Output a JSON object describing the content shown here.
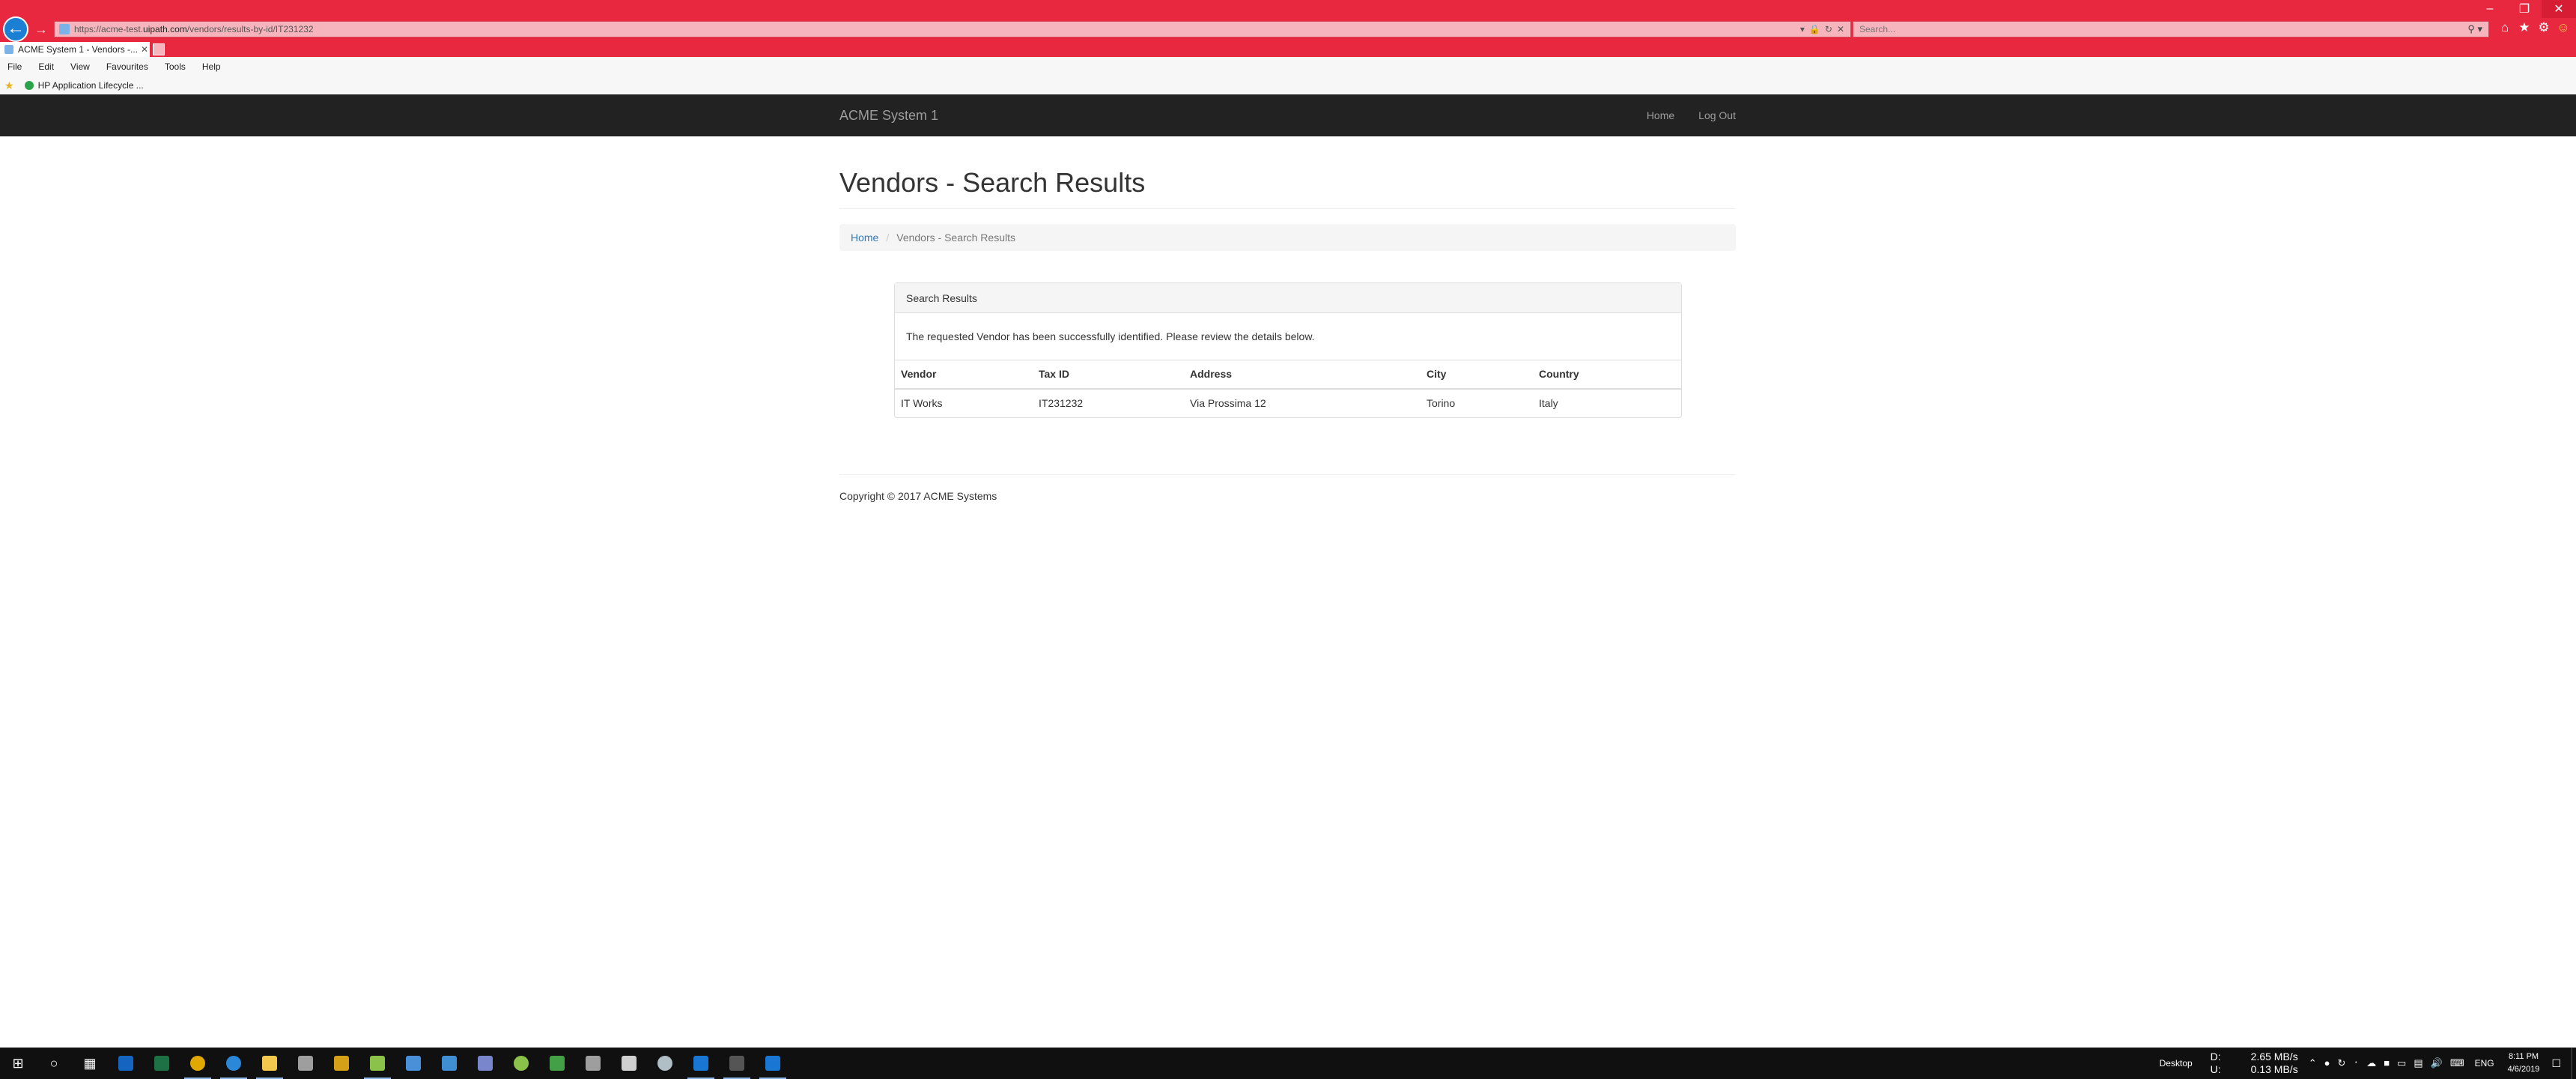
{
  "browser": {
    "url_prefix": "https://acme-test.",
    "url_host": "uipath.com",
    "url_path": "/vendors/results-by-id/IT231232",
    "search_placeholder": "Search...",
    "tab_title": "ACME System 1 - Vendors -...",
    "menu": [
      "File",
      "Edit",
      "View",
      "Favourites",
      "Tools",
      "Help"
    ],
    "favourite": "HP Application Lifecycle ..."
  },
  "site": {
    "brand": "ACME System 1",
    "nav": {
      "home": "Home",
      "logout": "Log Out"
    }
  },
  "page": {
    "title": "Vendors - Search Results",
    "breadcrumb": {
      "home": "Home",
      "separator": "/",
      "current": "Vendors - Search Results"
    },
    "panel": {
      "heading": "Search Results",
      "message": "The requested Vendor has been successfully identified. Please review the details below.",
      "columns": [
        "Vendor",
        "Tax ID",
        "Address",
        "City",
        "Country"
      ],
      "rows": [
        [
          "IT Works",
          "IT231232",
          "Via Prossima 12",
          "Torino",
          "Italy"
        ]
      ]
    },
    "footer": "Copyright © 2017 ACME Systems"
  },
  "taskbar": {
    "desktop_label": "Desktop",
    "net_down_label": "D:",
    "net_down": "2.65 MB/s",
    "net_up_label": "U:",
    "net_up": "0.13 MB/s",
    "lang": "ENG",
    "time": "8:11 PM",
    "date": "4/6/2019"
  },
  "colors": {
    "browser_chrome": "#e8283f",
    "navbar": "#222222",
    "link": "#337ab7",
    "taskbar": "#101010"
  }
}
